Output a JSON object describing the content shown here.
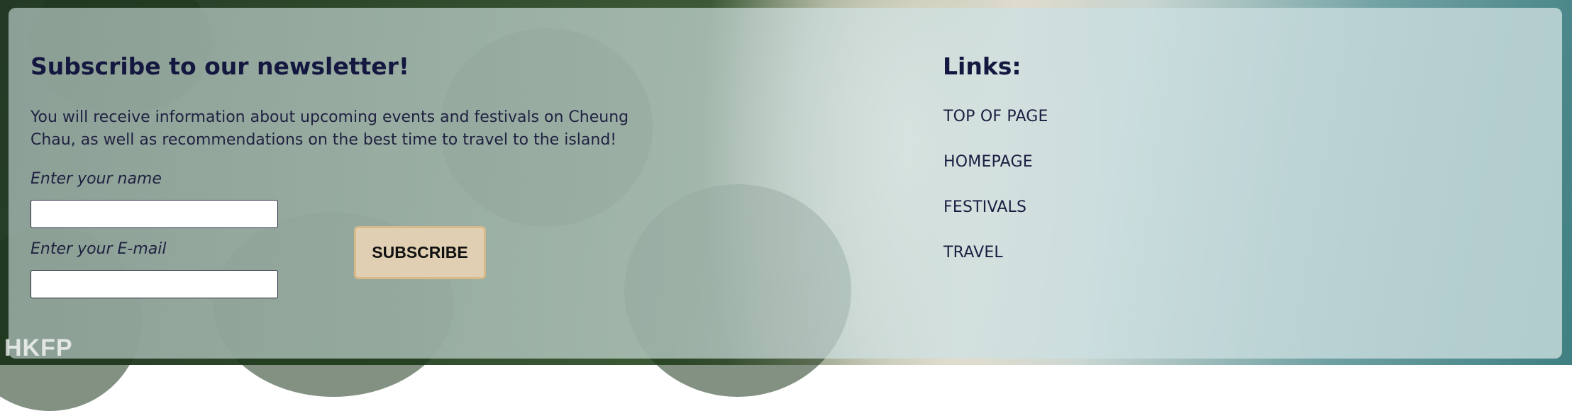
{
  "newsletter": {
    "title": "Subscribe to our newsletter!",
    "description": "You will receive information about upcoming events and festivals on Cheung Chau, as well as recommendations on the best time to travel to the island!",
    "name_label": "Enter your name",
    "name_value": "",
    "email_label": "Enter your E-mail",
    "email_value": "",
    "subscribe_label": "SUBSCRIBE"
  },
  "links": {
    "title": "Links:",
    "items": [
      {
        "label": "TOP OF PAGE"
      },
      {
        "label": "HOMEPAGE"
      },
      {
        "label": "FESTIVALS"
      },
      {
        "label": "TRAVEL"
      }
    ]
  },
  "watermark": "HKFP",
  "colors": {
    "heading_text": "#14173f",
    "button_bg": "#e0cfb3",
    "button_border": "#d8b98a"
  }
}
